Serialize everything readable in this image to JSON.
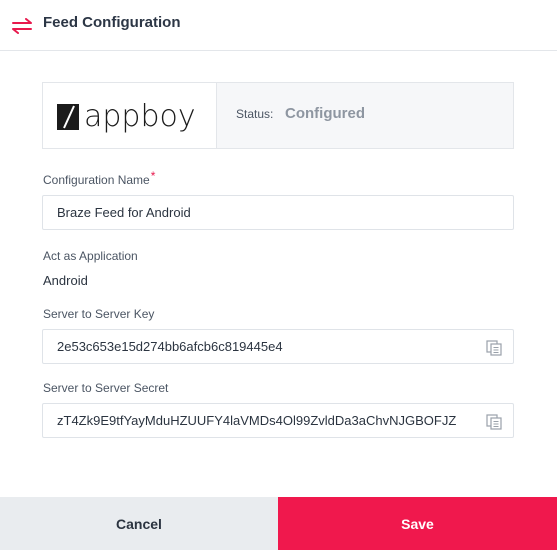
{
  "header": {
    "title": "Feed Configuration",
    "icon": "swap-arrows-icon",
    "icon_color": "#e8194d"
  },
  "integration": {
    "logo_text": "appboy",
    "status_label": "Status:",
    "status_value": "Configured"
  },
  "fields": {
    "config_name": {
      "label": "Configuration Name",
      "required_mark": "*",
      "value": "Braze Feed for Android"
    },
    "act_as_app": {
      "label": "Act as Application",
      "value": "Android"
    },
    "server_key": {
      "label": "Server to Server Key",
      "value": "2e53c653e15d274bb6afcb6c819445e4",
      "copy_icon": "copy-icon"
    },
    "server_secret": {
      "label": "Server to Server Secret",
      "value": "zT4Zk9E9tfYayMduHZUUFY4laVMDs4Ol99ZvldDa3aChvNJGBOFJZ",
      "copy_icon": "copy-icon"
    }
  },
  "footer": {
    "cancel_label": "Cancel",
    "save_label": "Save"
  },
  "colors": {
    "accent": "#f0184d",
    "cancel_bg": "#e9ecef",
    "status_text": "#8e96a1"
  }
}
